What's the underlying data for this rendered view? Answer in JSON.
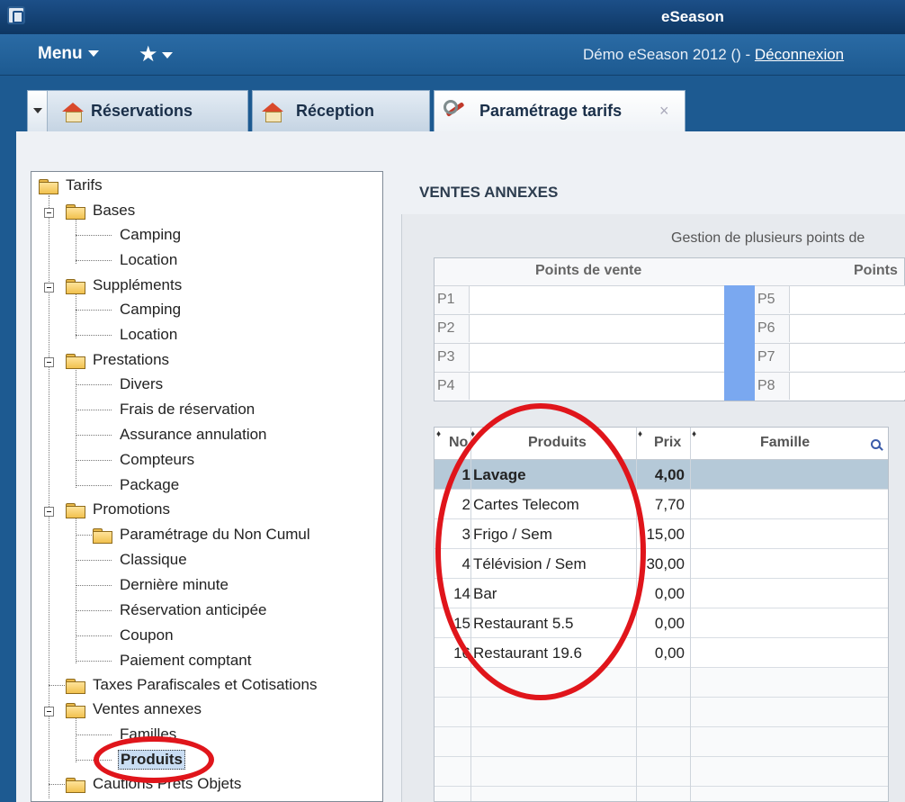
{
  "window": {
    "title": "eSeason"
  },
  "menubar": {
    "menu_label": "Menu",
    "favorites_label": "★",
    "session_text": "Démo eSeason 2012  () - ",
    "logout_label": "Déconnexion"
  },
  "tabs": [
    {
      "label": "Réservations",
      "icon": "home-icon"
    },
    {
      "label": "Réception",
      "icon": "home-icon"
    },
    {
      "label": "Paramétrage tarifs",
      "icon": "wrench-icon",
      "close": "×"
    }
  ],
  "tree": {
    "root": "Tarifs",
    "groups": [
      {
        "label": "Bases",
        "children": [
          "Camping",
          "Location"
        ]
      },
      {
        "label": "Suppléments",
        "children": [
          "Camping",
          "Location"
        ]
      },
      {
        "label": "Prestations",
        "children": [
          "Divers",
          "Frais de réservation",
          "Assurance annulation",
          "Compteurs",
          "Package"
        ]
      },
      {
        "label": "Promotions",
        "folder_child": "Paramétrage du Non Cumul",
        "children": [
          "Classique",
          "Dernière minute",
          "Réservation anticipée",
          "Coupon",
          "Paiement comptant"
        ]
      },
      {
        "label": "Taxes Parafiscales et Cotisations"
      },
      {
        "label": "Ventes annexes",
        "children": [
          "Familles",
          "Produits"
        ]
      },
      {
        "label": "Cautions Prêts Objets"
      }
    ],
    "selected": "Produits"
  },
  "main": {
    "section_title": "VENTES ANNEXES",
    "subtitle": "Gestion de plusieurs points de",
    "points_table": {
      "left_header": "Points de vente",
      "right_header": "Points",
      "left_codes": [
        "P1",
        "P2",
        "P3",
        "P4"
      ],
      "right_codes": [
        "P5",
        "P6",
        "P7",
        "P8"
      ]
    },
    "products_table": {
      "headers": {
        "no": "No",
        "produits": "Produits",
        "prix": "Prix",
        "famille": "Famille"
      },
      "rows": [
        {
          "no": "1",
          "produit": "Lavage",
          "prix": "4,00",
          "famille": ""
        },
        {
          "no": "2",
          "produit": "Cartes Telecom",
          "prix": "7,70",
          "famille": ""
        },
        {
          "no": "3",
          "produit": "Frigo / Sem",
          "prix": "15,00",
          "famille": ""
        },
        {
          "no": "4",
          "produit": "Télévision / Sem",
          "prix": "30,00",
          "famille": ""
        },
        {
          "no": "14",
          "produit": "Bar",
          "prix": "0,00",
          "famille": ""
        },
        {
          "no": "15",
          "produit": "Restaurant  5.5",
          "prix": "0,00",
          "famille": ""
        },
        {
          "no": "16",
          "produit": "Restaurant  19.6",
          "prix": "0,00",
          "famille": ""
        }
      ],
      "selected_row": 0
    }
  },
  "colors": {
    "titlebar": "#1c4f88",
    "menubar": "#2a6ba5",
    "selection": "#b5c9d8",
    "annotation": "#e0151b"
  }
}
